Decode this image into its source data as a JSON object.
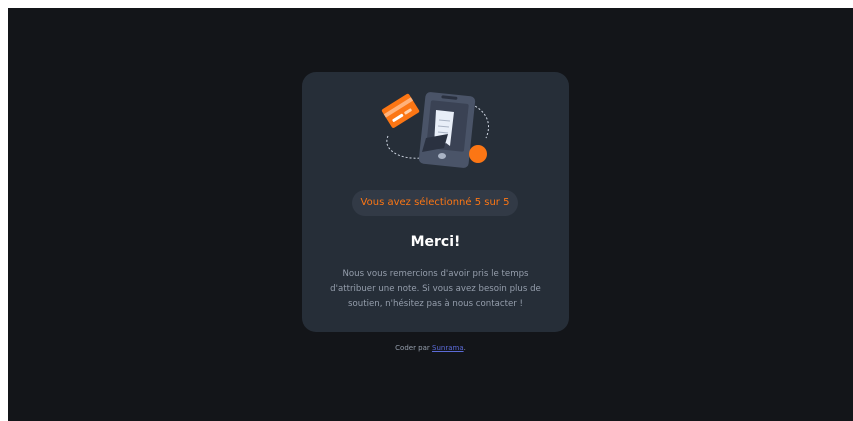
{
  "card": {
    "illustration": {
      "name": "phone-with-card-and-receipt-illustration",
      "colors": {
        "phone": "#4a5468",
        "card": "#fc7614",
        "receipt": "#e8eef8",
        "dot": "#fc7614"
      }
    },
    "selection_text": "Vous avez sélectionné 5 sur 5",
    "title": "Merci!",
    "message": "Nous vous remercions d'avoir pris le temps d'attribuer une note. Si vous avez besoin plus de soutien, n'hésitez pas à nous contacter !"
  },
  "attribution": {
    "prefix": "Coder par ",
    "author": "Sunrama",
    "suffix": "."
  },
  "colors": {
    "background": "#131519",
    "card": "#262e38",
    "accent": "#fc7614",
    "muted_text": "#959eac",
    "link": "#5b6ad6"
  }
}
